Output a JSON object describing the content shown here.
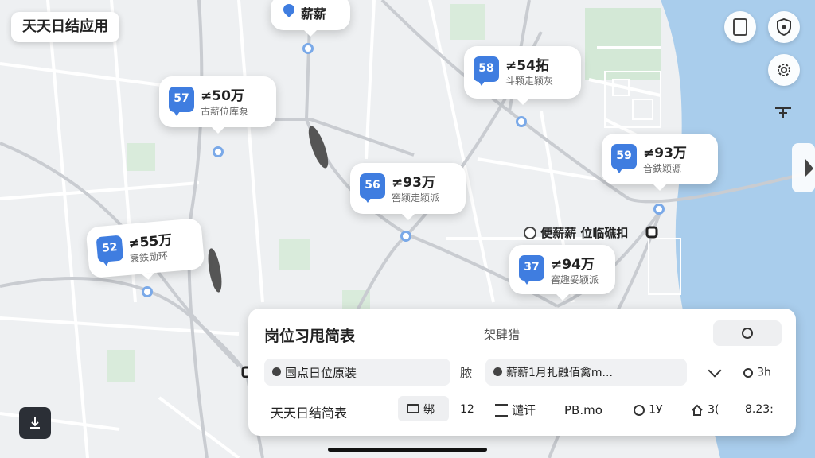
{
  "app_title": "天天日结应用",
  "top_marker": {
    "label": "薪薪"
  },
  "job_pins": [
    {
      "badge": "57",
      "salary": "≠50万",
      "sub": "古薪位库泵"
    },
    {
      "badge": "58",
      "salary": "≠54拓",
      "sub": "斗颗走颖灰"
    },
    {
      "badge": "56",
      "salary": "≠93万",
      "sub": "窖颖走颖派"
    },
    {
      "badge": "59",
      "salary": "≠93万",
      "sub": "音鉄颖源"
    },
    {
      "badge": "52",
      "salary": "≠55万",
      "sub": "衰鉄勋环"
    },
    {
      "badge": "37",
      "salary": "≠94万",
      "sub": "窖趣妥颖派"
    }
  ],
  "poi_label": "便薪薪 位临礁扣",
  "panel": {
    "title": "岗位习甩简表",
    "subtitle": "架肆猎",
    "location_field": "国点日位原装",
    "field_separator": "脓",
    "date_field": "薪薪1月扎融佰禽m...",
    "time_value": "3h",
    "bottom_title": "天天日结简表",
    "folder_label": "绑",
    "count": "12",
    "list_label": "谴讦",
    "pb_label": "PB.mo",
    "rate_value": "1У",
    "home_value": "3(",
    "distance_value": "8.23:"
  },
  "colors": {
    "accent": "#3f7de0",
    "water": "#a9cdec",
    "park": "#d3e8d6"
  }
}
